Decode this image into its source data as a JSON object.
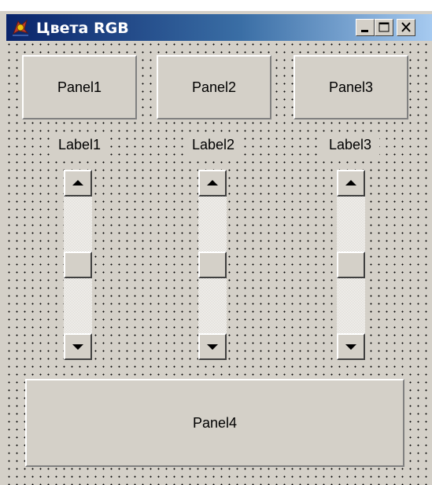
{
  "window": {
    "title": "Цвета RGB",
    "icon": "delphi-form-icon",
    "controls": [
      "minimize-icon",
      "maximize-icon",
      "close-icon"
    ]
  },
  "panels": [
    {
      "caption": "Panel1"
    },
    {
      "caption": "Panel2"
    },
    {
      "caption": "Panel3"
    },
    {
      "caption": "Panel4"
    }
  ],
  "labels": [
    {
      "caption": "Label1"
    },
    {
      "caption": "Label2"
    },
    {
      "caption": "Label3"
    }
  ],
  "scrollbars": [
    {
      "orientation": "vertical",
      "position_fraction": 0.5
    },
    {
      "orientation": "vertical",
      "position_fraction": 0.5
    },
    {
      "orientation": "vertical",
      "position_fraction": 0.5
    }
  ],
  "colors": {
    "face": "#d4d0c8",
    "title_start": "#0a246a",
    "title_end": "#a6caf0",
    "grid_dots": "#000000"
  }
}
